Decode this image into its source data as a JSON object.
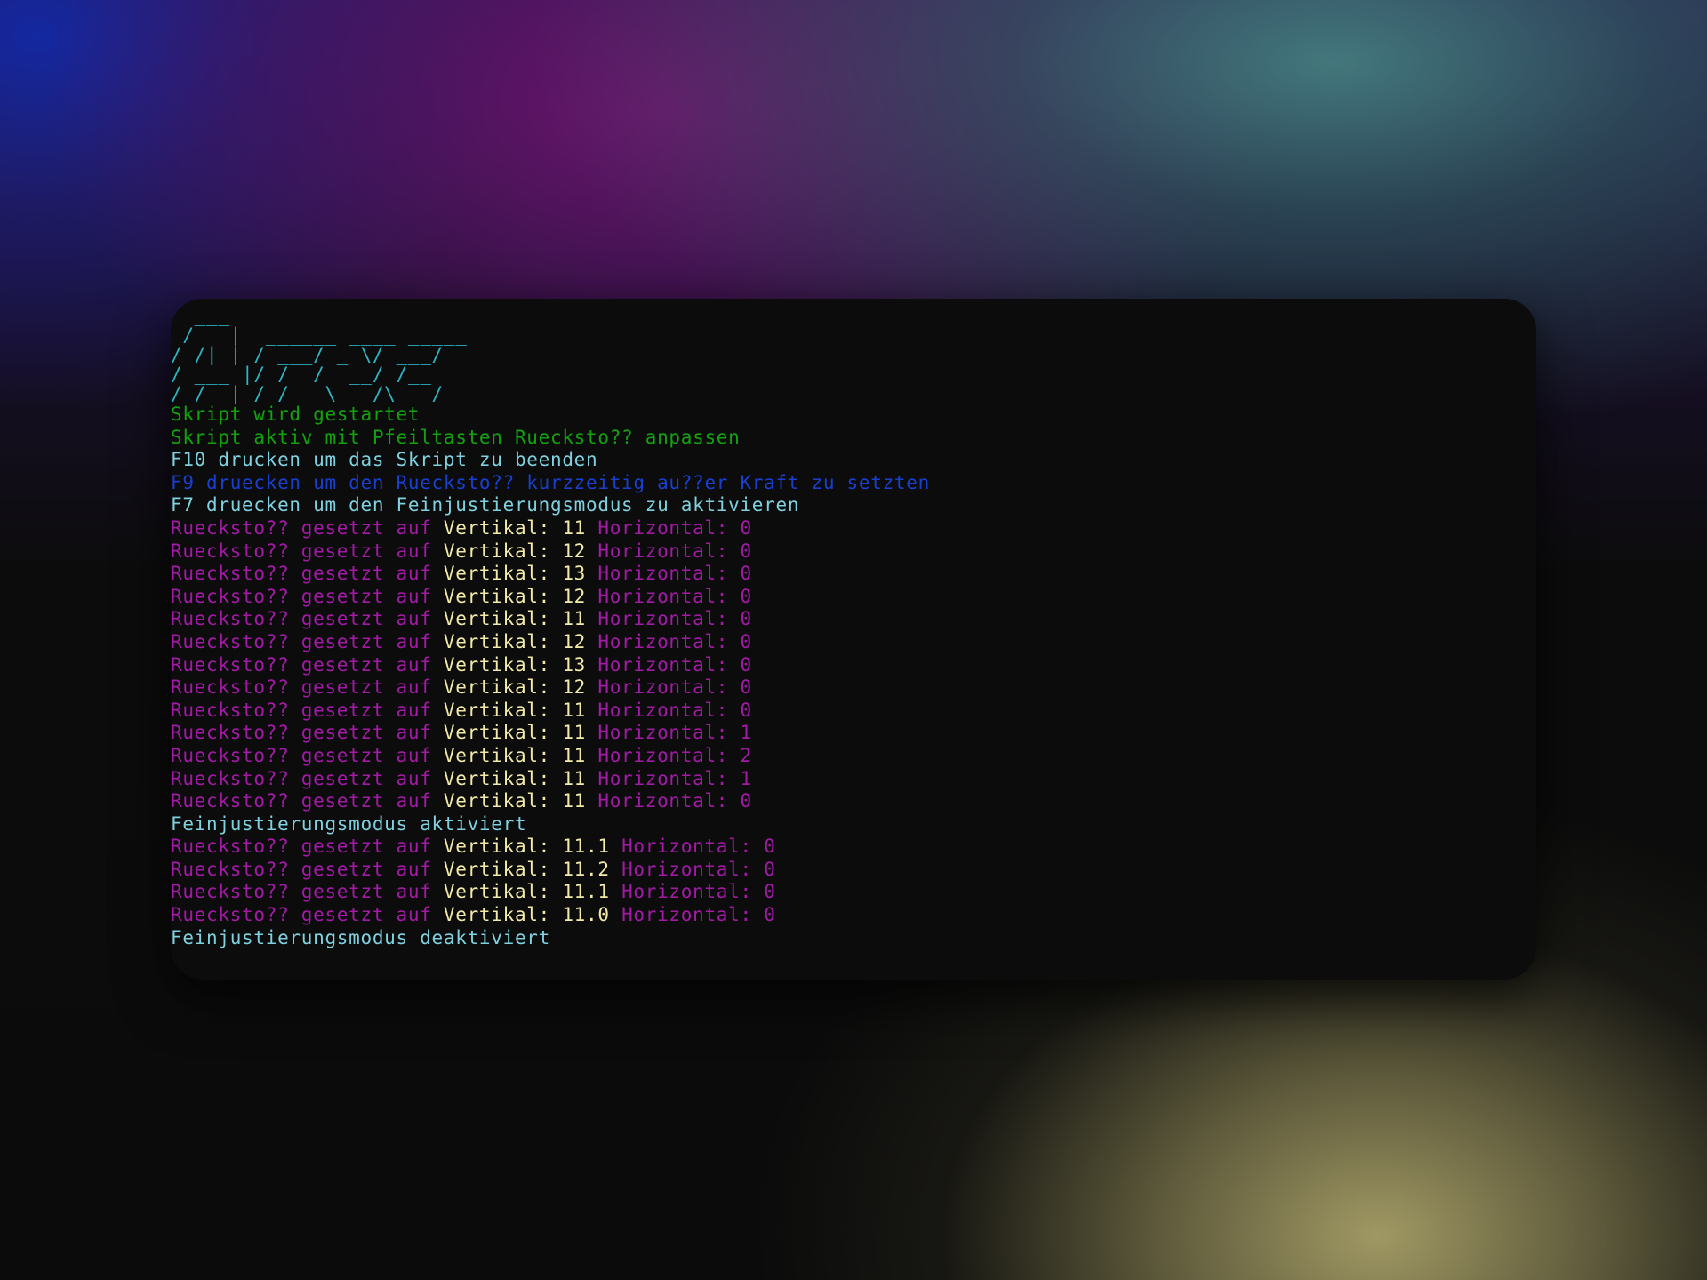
{
  "colors": {
    "green": "#13a10e",
    "cyan": "#7fd1df",
    "blue": "#1a3fd0",
    "magenta": "#a21aa6",
    "yellow": "#f2eaa8",
    "ascii": "#2fb5c4"
  },
  "banner": {
    "ascii_art": "  ___\n /   |  ______ ____ _____\n/ /| | / ___/ _ \\/ ___/\n/ ___ |/ /  /  __/ /__\n/_/  |_/_/   \\___/\\___/"
  },
  "console": {
    "startup": [
      {
        "text": "Skript wird gestartet",
        "color": "green"
      },
      {
        "text": "Skript aktiv mit Pfeiltasten Ruecksto?? anpassen",
        "color": "green"
      },
      {
        "text": "F10 drucken um das Skript zu beenden",
        "color": "cyan"
      },
      {
        "text": "F9 druecken um den Ruecksto?? kurzzeitig au??er Kraft zu setzten",
        "color": "blue"
      },
      {
        "text": "F7 druecken um den Feinjustierungsmodus zu aktivieren",
        "color": "cyan"
      }
    ],
    "recoil_prefix": "Ruecksto?? gesetzt auf",
    "vertical_label": "Vertikal:",
    "horizontal_label": "Horizontal:",
    "recoil_entries_1": [
      {
        "v": "11",
        "h": "0"
      },
      {
        "v": "12",
        "h": "0"
      },
      {
        "v": "13",
        "h": "0"
      },
      {
        "v": "12",
        "h": "0"
      },
      {
        "v": "11",
        "h": "0"
      },
      {
        "v": "12",
        "h": "0"
      },
      {
        "v": "13",
        "h": "0"
      },
      {
        "v": "12",
        "h": "0"
      },
      {
        "v": "11",
        "h": "0"
      },
      {
        "v": "11",
        "h": "1"
      },
      {
        "v": "11",
        "h": "2"
      },
      {
        "v": "11",
        "h": "1"
      },
      {
        "v": "11",
        "h": "0"
      }
    ],
    "fine_on": "Feinjustierungsmodus aktiviert",
    "recoil_entries_2": [
      {
        "v": "11.1",
        "h": "0"
      },
      {
        "v": "11.2",
        "h": "0"
      },
      {
        "v": "11.1",
        "h": "0"
      },
      {
        "v": "11.0",
        "h": "0"
      }
    ],
    "fine_off": "Feinjustierungsmodus deaktiviert"
  }
}
